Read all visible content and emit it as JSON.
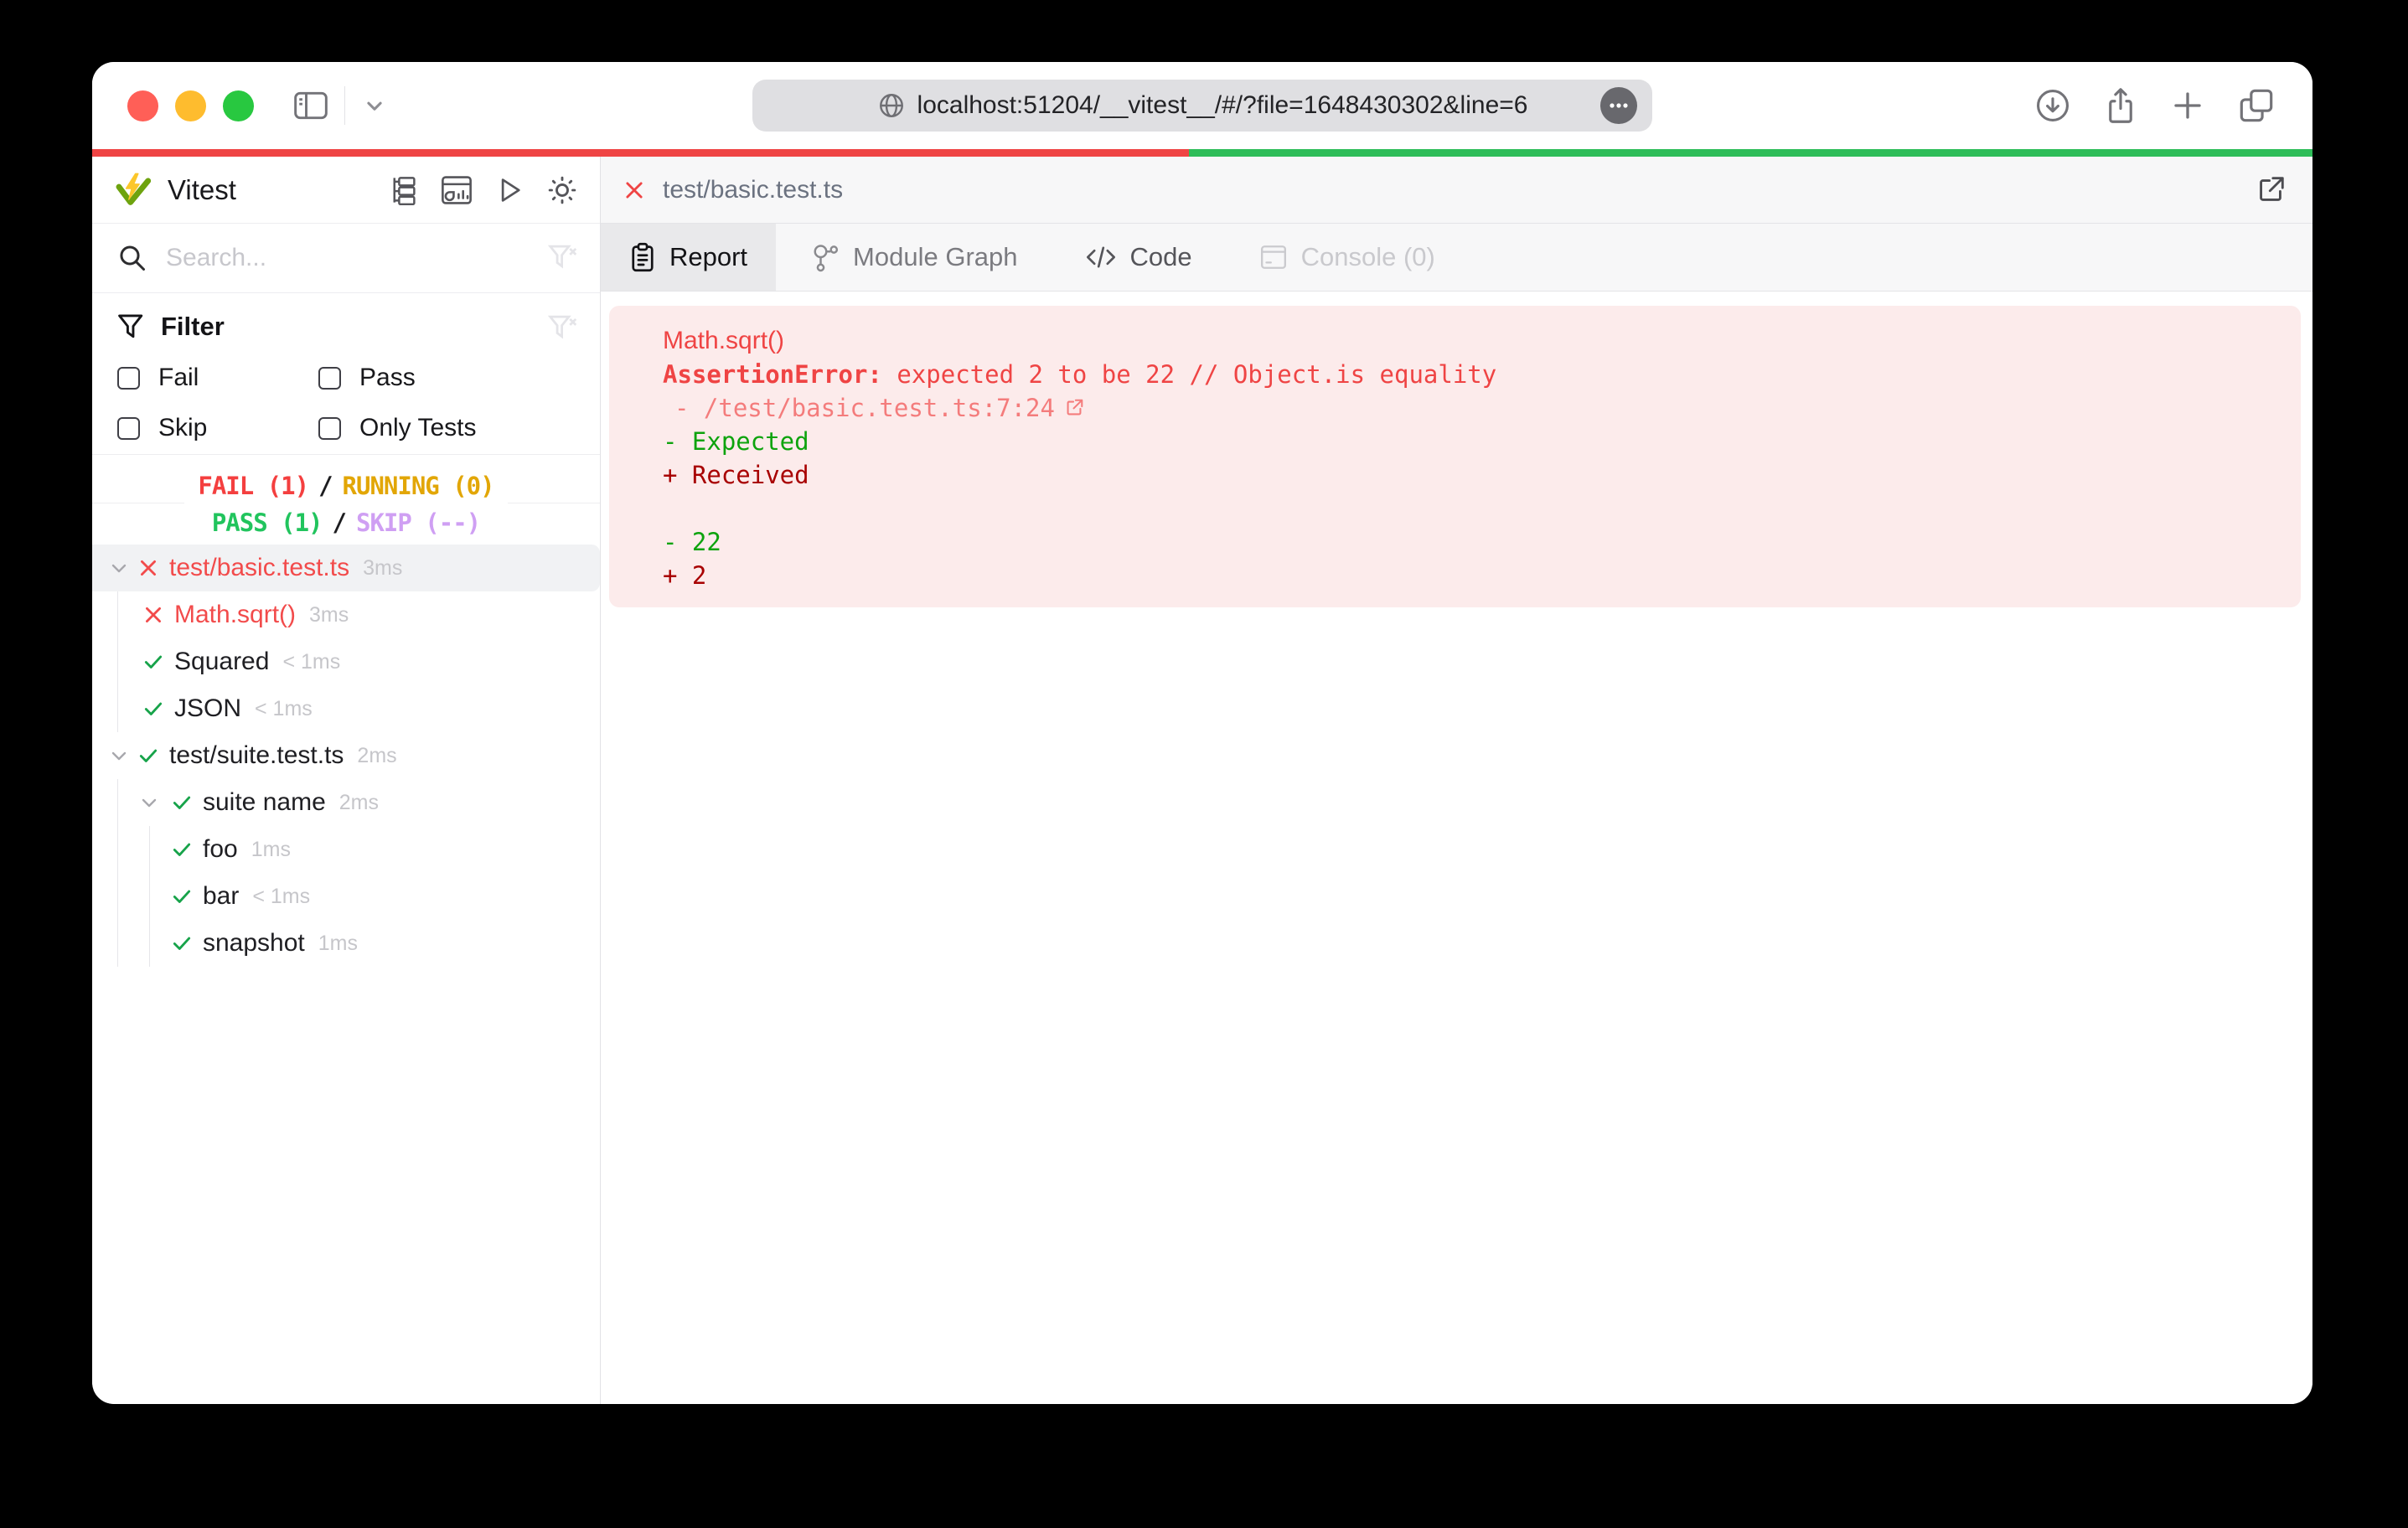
{
  "browser": {
    "url": "localhost:51204/__vitest__/#/?file=1648430302&line=6",
    "traffic_lights": [
      "close",
      "minimize",
      "zoom"
    ],
    "left_icons": [
      "sidebar-toggle-icon",
      "chevron-down-icon"
    ],
    "url_icons": [
      "globe-icon",
      "more-icon"
    ],
    "right_icons": [
      "download-icon",
      "share-icon",
      "new-tab-icon",
      "tabs-overview-icon"
    ]
  },
  "progress": {
    "fail_percent": 49.4,
    "fail_color": "#ef4444",
    "pass_color": "#2ebd59"
  },
  "sidebar": {
    "title": "Vitest",
    "header_icons": [
      "tree-view-icon",
      "dashboard-icon",
      "run-all-icon",
      "theme-sun-icon"
    ],
    "search": {
      "placeholder": "Search...",
      "icons": [
        "search-icon",
        "clear-filter-icon"
      ]
    },
    "filter": {
      "title": "Filter",
      "icons": [
        "funnel-icon",
        "clear-filter-icon"
      ],
      "options": [
        {
          "label": "Fail",
          "checked": false
        },
        {
          "label": "Pass",
          "checked": false
        },
        {
          "label": "Skip",
          "checked": false
        },
        {
          "label": "Only Tests",
          "checked": false
        }
      ]
    },
    "summary": {
      "fail": "FAIL (1)",
      "sep1": "/",
      "running": "RUNNING (0)",
      "pass": "PASS (1)",
      "sep2": "/",
      "skip": "SKIP (--)"
    },
    "tree": [
      {
        "label": "test/basic.test.ts",
        "time": "3ms",
        "status": "fail",
        "type": "file",
        "expanded": true,
        "selected": true
      },
      {
        "label": "Math.sqrt()",
        "time": "3ms",
        "status": "fail",
        "type": "test"
      },
      {
        "label": "Squared",
        "time": "< 1ms",
        "status": "pass",
        "type": "test"
      },
      {
        "label": "JSON",
        "time": "< 1ms",
        "status": "pass",
        "type": "test"
      },
      {
        "label": "test/suite.test.ts",
        "time": "2ms",
        "status": "pass",
        "type": "file",
        "expanded": true
      },
      {
        "label": "suite name",
        "time": "2ms",
        "status": "pass",
        "type": "suite",
        "expanded": true
      },
      {
        "label": "foo",
        "time": "1ms",
        "status": "pass",
        "type": "subtest"
      },
      {
        "label": "bar",
        "time": "< 1ms",
        "status": "pass",
        "type": "subtest"
      },
      {
        "label": "snapshot",
        "time": "1ms",
        "status": "pass",
        "type": "subtest"
      }
    ]
  },
  "main": {
    "file_tab": {
      "label": "test/basic.test.ts",
      "icons": [
        "close-icon",
        "open-external-icon"
      ]
    },
    "tabs": [
      {
        "label": "Report",
        "icon": "clipboard-icon",
        "active": true
      },
      {
        "label": "Module Graph",
        "icon": "module-graph-icon",
        "active": false
      },
      {
        "label": "Code",
        "icon": "code-icon",
        "active": false
      },
      {
        "label": "Console (0)",
        "icon": "console-icon",
        "active": false,
        "disabled": true
      }
    ],
    "report": {
      "test_name": "Math.sqrt()",
      "error_name": "AssertionError:",
      "error_message": " expected 2 to be 22 // Object.is equality",
      "stack_link": "- /test/basic.test.ts:7:24",
      "diff_expected_label": "- Expected",
      "diff_received_label": "+ Received",
      "diff_expected_value": "- 22",
      "diff_received_value": "+ 2"
    }
  },
  "colors": {
    "fail": "#f43f3f",
    "running": "#e2a606",
    "pass": "#21c45d",
    "skip": "#cf9ff3",
    "error_panel_bg": "#fcebeb",
    "diff_expected": "#0da30d",
    "diff_received": "#a80000"
  }
}
